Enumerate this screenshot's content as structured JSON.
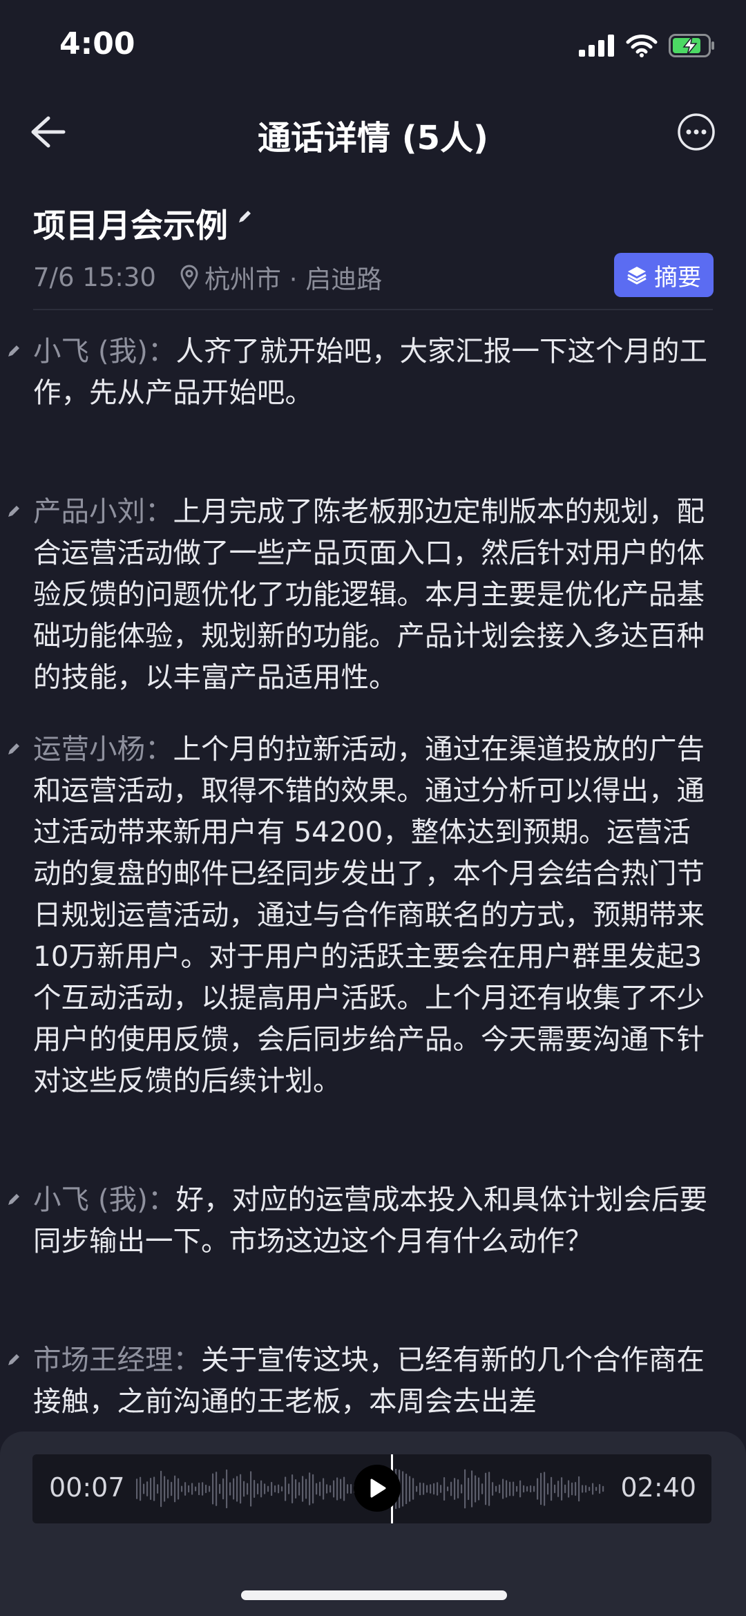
{
  "status_bar": {
    "time": "4:00"
  },
  "nav": {
    "title": "通话详情 (5人)"
  },
  "header": {
    "title": "项目月会示例",
    "datetime": "7/6 15:30",
    "location": "杭州市 · 启迪路",
    "summary_button": "摘要"
  },
  "transcript": [
    {
      "speaker": "小飞 (我)：",
      "text": "人齐了就开始吧，大家汇报一下这个月的工作，先从产品开始吧。"
    },
    {
      "speaker": "产品小刘：",
      "text": "上月完成了陈老板那边定制版本的规划，配合运营活动做了一些产品页面入口，然后针对用户的体验反馈的问题优化了功能逻辑。本月主要是优化产品基础功能体验，规划新的功能。产品计划会接入多达百种的技能，以丰富产品适用性。"
    },
    {
      "speaker": "运营小杨：",
      "text": "上个月的拉新活动，通过在渠道投放的广告和运营活动，取得不错的效果。通过分析可以得出，通过活动带来新用户有 54200，整体达到预期。运营活动的复盘的邮件已经同步发出了，本个月会结合热门节日规划运营活动，通过与合作商联名的方式，预期带来10万新用户。对于用户的活跃主要会在用户群里发起3个互动活动，以提高用户活跃。上个月还有收集了不少用户的使用反馈，会后同步给产品。今天需要沟通下针对这些反馈的后续计划。"
    },
    {
      "speaker": "小飞 (我)：",
      "text": "好，对应的运营成本投入和具体计划会后要同步输出一下。市场这边这个月有什么动作？"
    },
    {
      "speaker": "市场王经理：",
      "text": "关于宣传这块，已经有新的几个合作商在接触，之前沟通的王老板，本周会去出差"
    }
  ],
  "player": {
    "current_time": "00:07",
    "total_time": "02:40",
    "progress": 0.044
  }
}
